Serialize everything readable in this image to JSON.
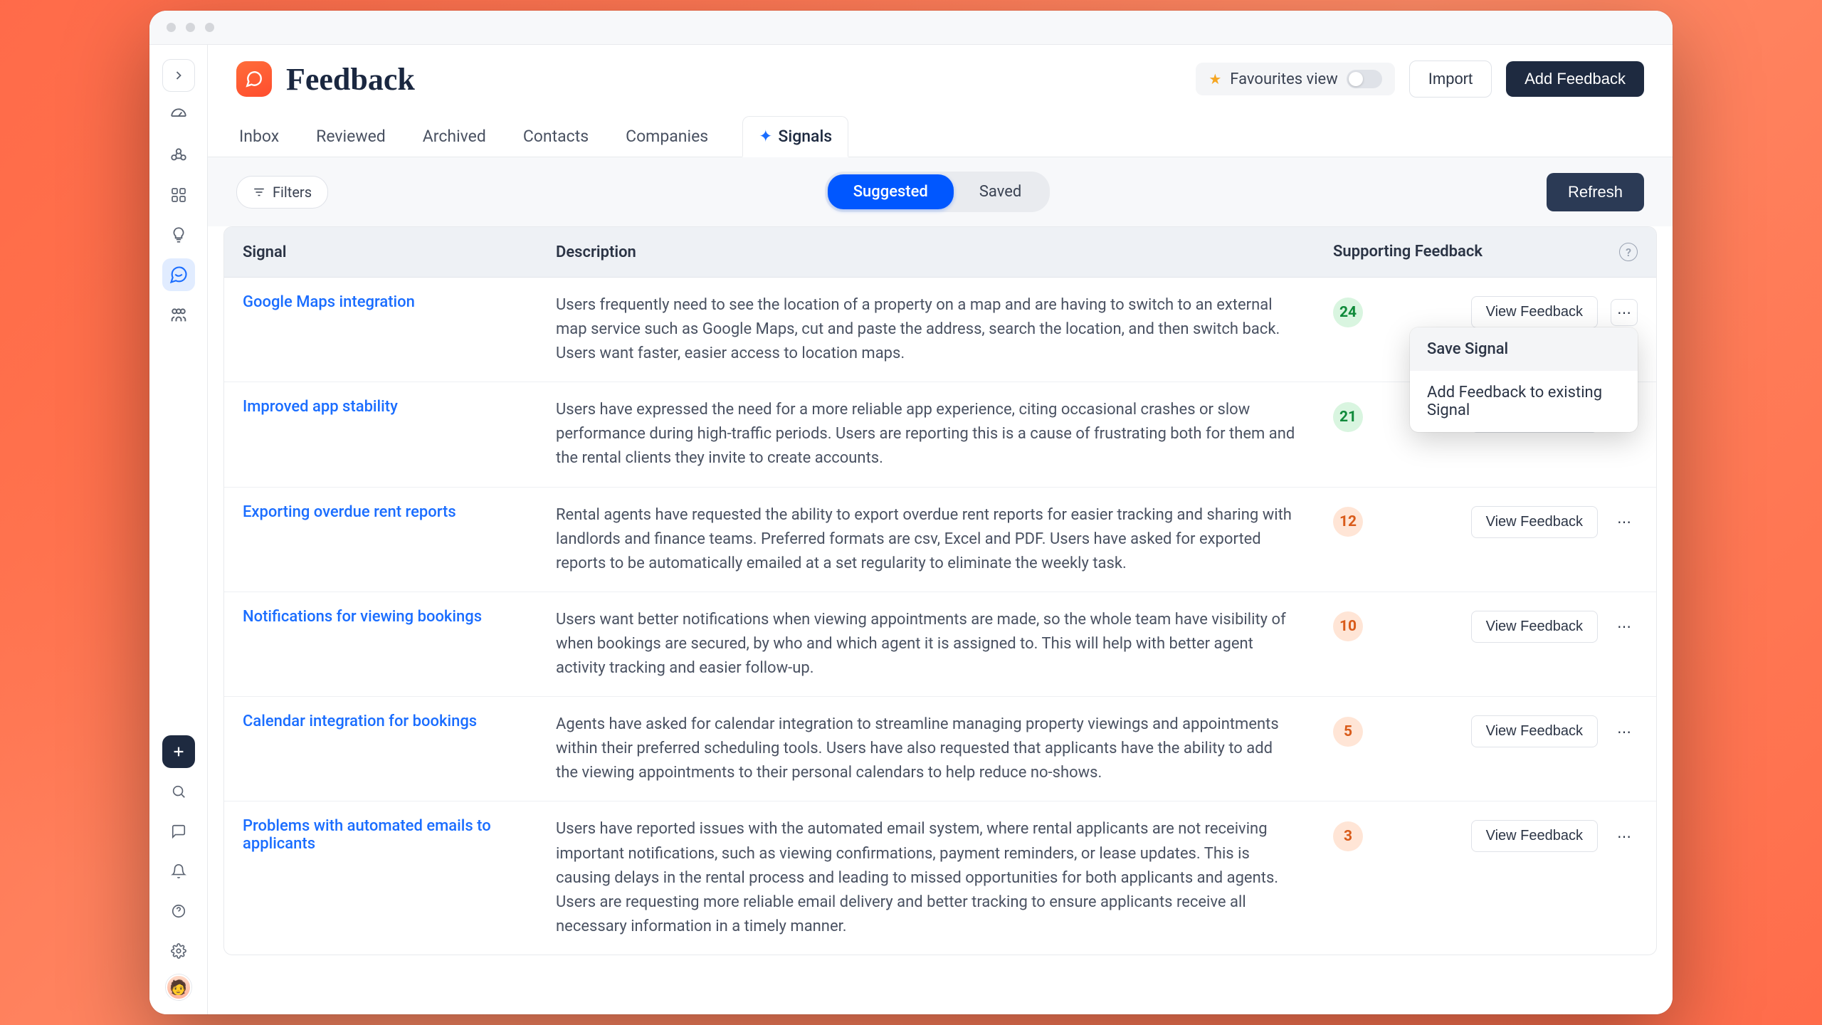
{
  "page": {
    "title": "Feedback"
  },
  "header": {
    "favourites_label": "Favourites view",
    "import_label": "Import",
    "add_feedback_label": "Add Feedback"
  },
  "tabs": [
    "Inbox",
    "Reviewed",
    "Archived",
    "Contacts",
    "Companies",
    "Signals"
  ],
  "active_tab": 5,
  "toolbar": {
    "filters_label": "Filters",
    "seg_suggested": "Suggested",
    "seg_saved": "Saved",
    "active_seg": 0,
    "refresh_label": "Refresh"
  },
  "table": {
    "col_signal": "Signal",
    "col_description": "Description",
    "col_support": "Supporting Feedback",
    "view_feedback_label": "View Feedback",
    "rows": [
      {
        "signal": "Google Maps integration",
        "description": "Users frequently need to see the location of a property on a map and are having to switch to an external map service such as Google Maps, cut and paste the address, search the location, and then switch back. Users want faster, easier access to location maps.",
        "count": 24,
        "badge": "green",
        "menu_open": true
      },
      {
        "signal": "Improved app stability",
        "description": "Users have expressed the need for a more reliable app experience, citing occasional crashes or slow performance during high-traffic periods. Users are reporting this is a cause of frustrating both for them and the rental clients they invite to create accounts.",
        "count": 21,
        "badge": "green"
      },
      {
        "signal": "Exporting overdue rent reports",
        "description": "Rental agents have requested the ability to export overdue rent reports for easier tracking and sharing with landlords and finance teams. Preferred formats are csv, Excel and PDF. Users have asked for exported reports to be automatically emailed at a set regularity to eliminate the weekly task.",
        "count": 12,
        "badge": "orange"
      },
      {
        "signal": "Notifications for viewing bookings",
        "description": "Users want better notifications when viewing appointments are made, so the whole team have visibility of when bookings are secured, by who and which agent it is assigned to. This will help with better agent activity tracking and easier follow-up.",
        "count": 10,
        "badge": "orange"
      },
      {
        "signal": "Calendar integration for bookings",
        "description": "Agents have asked for calendar integration to streamline managing property viewings and appointments within their preferred scheduling tools. Users have also requested that applicants have the ability to add the viewing appointments to their personal calendars to help reduce no-shows.",
        "count": 5,
        "badge": "orange"
      },
      {
        "signal": "Problems with automated emails to applicants",
        "description": "Users have reported issues with the automated email system, where rental applicants are not receiving important notifications, such as viewing confirmations, payment reminders, or lease updates. This is causing delays in the rental process and leading to missed opportunities for both applicants and agents. Users are requesting more reliable email delivery and better tracking to ensure applicants receive all necessary information in a timely manner.",
        "count": 3,
        "badge": "orange"
      }
    ]
  },
  "dropdown": {
    "save_signal": "Save Signal",
    "add_to_existing": "Add Feedback to existing Signal"
  }
}
